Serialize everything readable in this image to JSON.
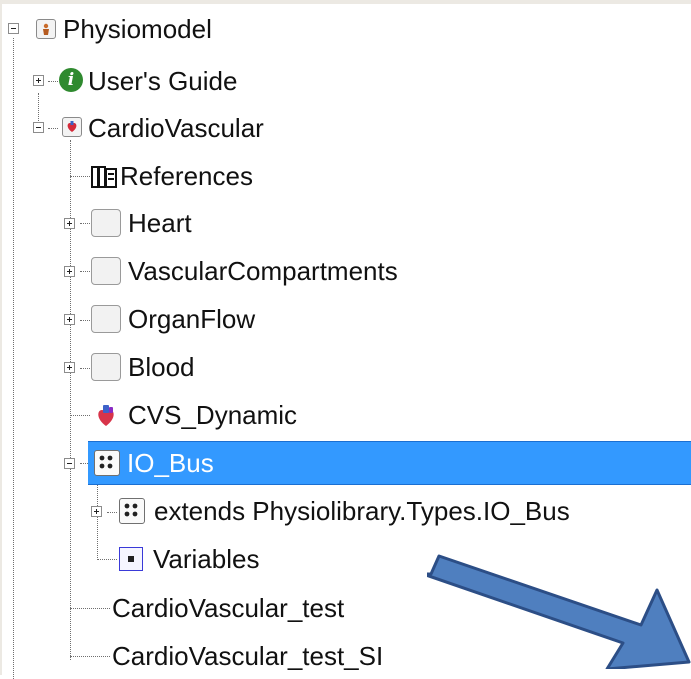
{
  "tree": {
    "root": {
      "label": "Physiomodel",
      "icon": "physiomodel-package-icon",
      "expanded": true
    },
    "items": [
      {
        "label": "User's Guide",
        "icon": "info-icon",
        "expanded": false
      },
      {
        "label": "CardioVascular",
        "icon": "cardiovascular-package-icon",
        "expanded": true,
        "children": [
          {
            "label": "References",
            "icon": "book-icon"
          },
          {
            "label": "Heart",
            "icon": "empty-package-icon",
            "expanded": false
          },
          {
            "label": "VascularCompartments",
            "icon": "empty-package-icon",
            "expanded": false
          },
          {
            "label": "OrganFlow",
            "icon": "empty-package-icon",
            "expanded": false
          },
          {
            "label": "Blood",
            "icon": "empty-package-icon",
            "expanded": false
          },
          {
            "label": "CVS_Dynamic",
            "icon": "heart-model-icon"
          },
          {
            "label": "IO_Bus",
            "icon": "bus-connector-icon",
            "expanded": true,
            "selected": true,
            "children": [
              {
                "label": "extends Physiolibrary.Types.IO_Bus",
                "icon": "bus-connector-icon",
                "expanded": false
              },
              {
                "label": "Variables",
                "icon": "variable-icon"
              }
            ]
          },
          {
            "label": "CardioVascular_test"
          },
          {
            "label": "CardioVascular_test_SI"
          }
        ]
      }
    ]
  },
  "annotation": {
    "icon": "arrow-right-down-icon",
    "color": "#4f7fbf",
    "border_color": "#2c4e86"
  },
  "colors": {
    "selection": "#3399ff",
    "background": "#ffffff",
    "frame": "#ece9e3"
  }
}
